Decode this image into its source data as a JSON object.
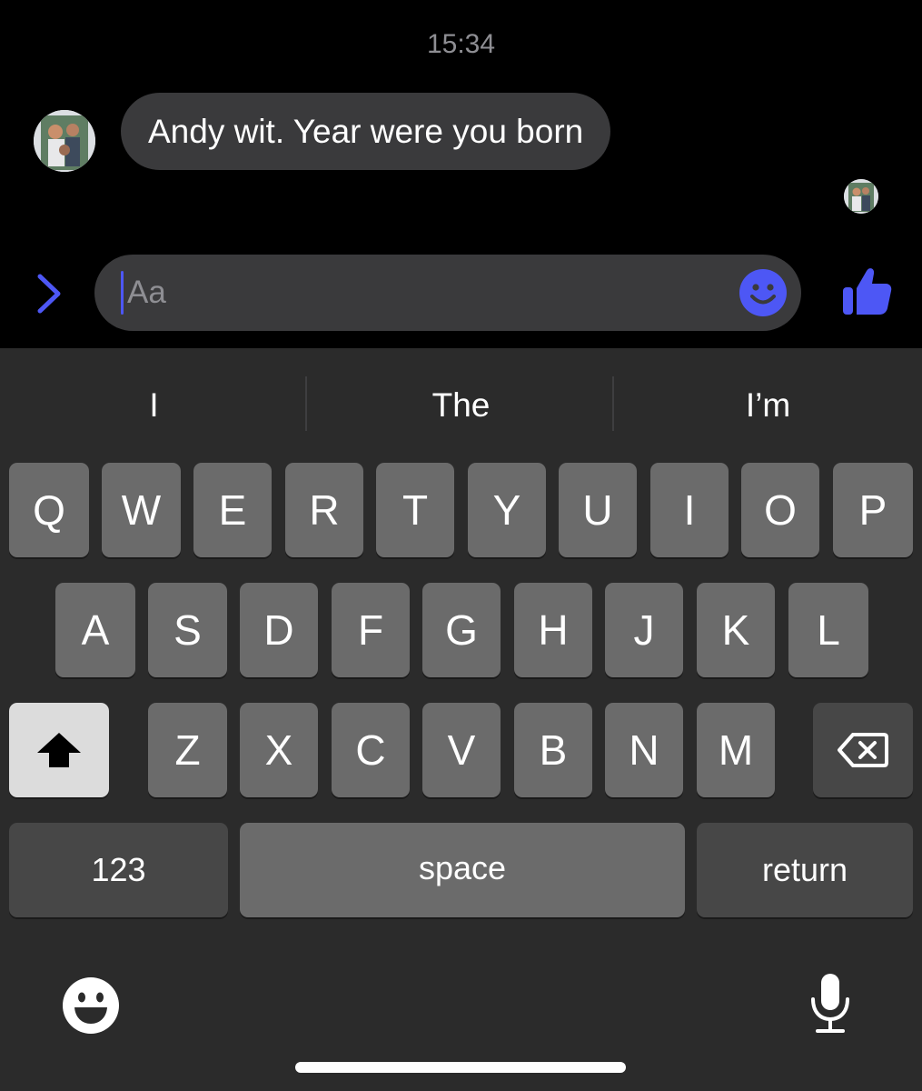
{
  "conversation": {
    "timestamp": "15:34",
    "message": {
      "text": "Andy wit. Year were you born"
    }
  },
  "composer": {
    "placeholder": "Aa",
    "value": ""
  },
  "icons": {
    "expand": "chevron-right-icon",
    "emoji": "smiley-icon",
    "like": "thumbs-up-icon",
    "shift": "shift-arrow-icon",
    "delete": "backspace-icon",
    "keyboard_emoji": "emoji-keyboard-icon",
    "dictation": "microphone-icon"
  },
  "keyboard": {
    "suggestions": [
      "I",
      "The",
      "I’m"
    ],
    "row1": [
      "Q",
      "W",
      "E",
      "R",
      "T",
      "Y",
      "U",
      "I",
      "O",
      "P"
    ],
    "row2": [
      "A",
      "S",
      "D",
      "F",
      "G",
      "H",
      "J",
      "K",
      "L"
    ],
    "row3": [
      "Z",
      "X",
      "C",
      "V",
      "B",
      "N",
      "M"
    ],
    "numbers_label": "123",
    "space_label": "space",
    "return_label": "return"
  },
  "colors": {
    "accent": "#4d57f5",
    "background": "#000000",
    "bubble": "#3a3a3c",
    "keyboard": "#2b2b2b",
    "key": "#6b6b6b",
    "key_dark": "#474747",
    "shift_active": "#dcdcdc"
  }
}
